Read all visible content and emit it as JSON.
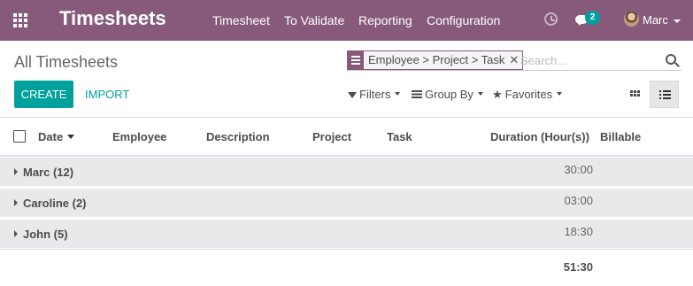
{
  "navbar": {
    "brand": "Timesheets",
    "menu": [
      "Timesheet",
      "To Validate",
      "Reporting",
      "Configuration"
    ],
    "messages_count": "2",
    "user_name": "Marc",
    "icons": [
      "apps-grid-icon",
      "clock-icon",
      "chat-icon",
      "avatar"
    ]
  },
  "control_panel": {
    "title": "All Timesheets",
    "facet": "Employee > Project > Task",
    "search_placeholder": "Search...",
    "create_label": "CREATE",
    "import_label": "IMPORT",
    "filters_label": "Filters",
    "groupby_label": "Group By",
    "favorites_label": "Favorites",
    "active_view": "list"
  },
  "table": {
    "columns": [
      "Date",
      "Employee",
      "Description",
      "Project",
      "Task",
      "Duration (Hour(s))",
      "Billable"
    ],
    "groups": [
      {
        "label": "Marc (12)",
        "duration": "30:00"
      },
      {
        "label": "Caroline (2)",
        "duration": "03:00"
      },
      {
        "label": "John (5)",
        "duration": "18:30"
      }
    ],
    "total": "51:30"
  },
  "colors": {
    "brand": "#875a7b",
    "accent": "#00a09d",
    "group_row": "#e9e9ec"
  }
}
